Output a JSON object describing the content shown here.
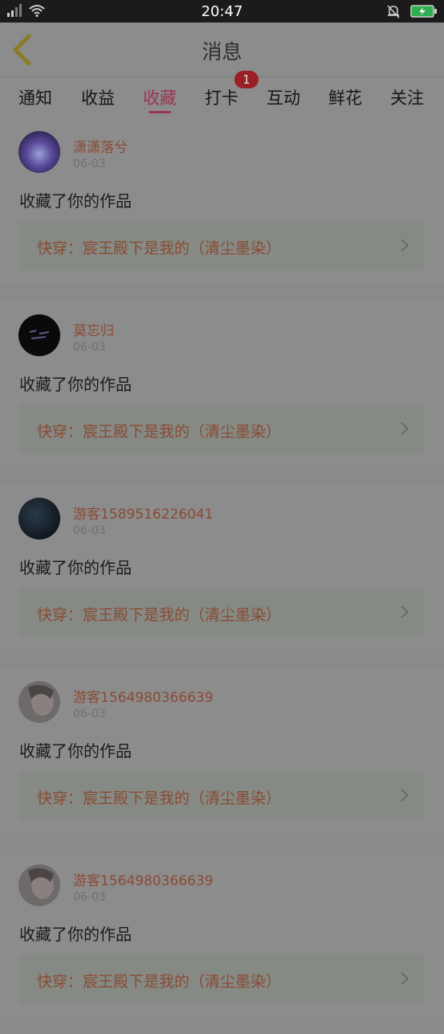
{
  "statusbar": {
    "time": "20:47"
  },
  "header": {
    "title": "消息"
  },
  "tabs": [
    {
      "label": "通知"
    },
    {
      "label": "收益"
    },
    {
      "label": "收藏"
    },
    {
      "label": "打卡"
    },
    {
      "label": "互动"
    },
    {
      "label": "鲜花"
    },
    {
      "label": "关注"
    }
  ],
  "active_tab": "收藏",
  "badge": {
    "count": "1"
  },
  "items": [
    {
      "username": "潇潇落兮",
      "date": "06-03",
      "action": "收藏了你的作品",
      "work": "快穿：宸王殿下是我的（清尘墨染）"
    },
    {
      "username": "莫忘归",
      "date": "06-03",
      "action": "收藏了你的作品",
      "work": "快穿：宸王殿下是我的（清尘墨染）"
    },
    {
      "username": "游客1589516226041",
      "date": "06-03",
      "action": "收藏了你的作品",
      "work": "快穿：宸王殿下是我的（清尘墨染）"
    },
    {
      "username": "游客1564980366639",
      "date": "06-03",
      "action": "收藏了你的作品",
      "work": "快穿：宸王殿下是我的（清尘墨染）"
    },
    {
      "username": "游客1564980366639",
      "date": "06-03",
      "action": "收藏了你的作品",
      "work": "快穿：宸王殿下是我的（清尘墨染）"
    }
  ],
  "colors": {
    "accent": "#9c3452",
    "username": "#8a4a34",
    "badge": "#9a1f24"
  }
}
